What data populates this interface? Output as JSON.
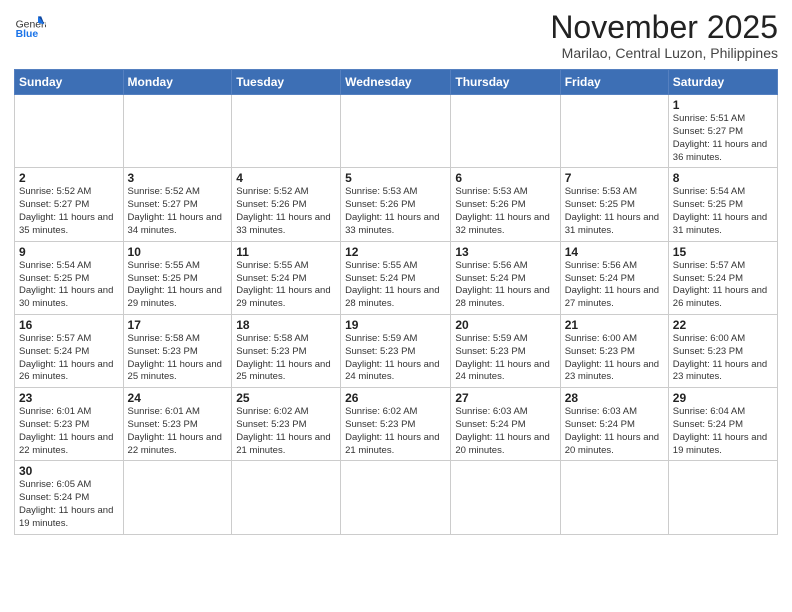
{
  "header": {
    "logo_general": "General",
    "logo_blue": "Blue",
    "month_title": "November 2025",
    "location": "Marilao, Central Luzon, Philippines"
  },
  "weekdays": [
    "Sunday",
    "Monday",
    "Tuesday",
    "Wednesday",
    "Thursday",
    "Friday",
    "Saturday"
  ],
  "weeks": [
    [
      {
        "day": "",
        "info": ""
      },
      {
        "day": "",
        "info": ""
      },
      {
        "day": "",
        "info": ""
      },
      {
        "day": "",
        "info": ""
      },
      {
        "day": "",
        "info": ""
      },
      {
        "day": "",
        "info": ""
      },
      {
        "day": "1",
        "info": "Sunrise: 5:51 AM\nSunset: 5:27 PM\nDaylight: 11 hours and 36 minutes."
      }
    ],
    [
      {
        "day": "2",
        "info": "Sunrise: 5:52 AM\nSunset: 5:27 PM\nDaylight: 11 hours and 35 minutes."
      },
      {
        "day": "3",
        "info": "Sunrise: 5:52 AM\nSunset: 5:27 PM\nDaylight: 11 hours and 34 minutes."
      },
      {
        "day": "4",
        "info": "Sunrise: 5:52 AM\nSunset: 5:26 PM\nDaylight: 11 hours and 33 minutes."
      },
      {
        "day": "5",
        "info": "Sunrise: 5:53 AM\nSunset: 5:26 PM\nDaylight: 11 hours and 33 minutes."
      },
      {
        "day": "6",
        "info": "Sunrise: 5:53 AM\nSunset: 5:26 PM\nDaylight: 11 hours and 32 minutes."
      },
      {
        "day": "7",
        "info": "Sunrise: 5:53 AM\nSunset: 5:25 PM\nDaylight: 11 hours and 31 minutes."
      },
      {
        "day": "8",
        "info": "Sunrise: 5:54 AM\nSunset: 5:25 PM\nDaylight: 11 hours and 31 minutes."
      }
    ],
    [
      {
        "day": "9",
        "info": "Sunrise: 5:54 AM\nSunset: 5:25 PM\nDaylight: 11 hours and 30 minutes."
      },
      {
        "day": "10",
        "info": "Sunrise: 5:55 AM\nSunset: 5:25 PM\nDaylight: 11 hours and 29 minutes."
      },
      {
        "day": "11",
        "info": "Sunrise: 5:55 AM\nSunset: 5:24 PM\nDaylight: 11 hours and 29 minutes."
      },
      {
        "day": "12",
        "info": "Sunrise: 5:55 AM\nSunset: 5:24 PM\nDaylight: 11 hours and 28 minutes."
      },
      {
        "day": "13",
        "info": "Sunrise: 5:56 AM\nSunset: 5:24 PM\nDaylight: 11 hours and 28 minutes."
      },
      {
        "day": "14",
        "info": "Sunrise: 5:56 AM\nSunset: 5:24 PM\nDaylight: 11 hours and 27 minutes."
      },
      {
        "day": "15",
        "info": "Sunrise: 5:57 AM\nSunset: 5:24 PM\nDaylight: 11 hours and 26 minutes."
      }
    ],
    [
      {
        "day": "16",
        "info": "Sunrise: 5:57 AM\nSunset: 5:24 PM\nDaylight: 11 hours and 26 minutes."
      },
      {
        "day": "17",
        "info": "Sunrise: 5:58 AM\nSunset: 5:23 PM\nDaylight: 11 hours and 25 minutes."
      },
      {
        "day": "18",
        "info": "Sunrise: 5:58 AM\nSunset: 5:23 PM\nDaylight: 11 hours and 25 minutes."
      },
      {
        "day": "19",
        "info": "Sunrise: 5:59 AM\nSunset: 5:23 PM\nDaylight: 11 hours and 24 minutes."
      },
      {
        "day": "20",
        "info": "Sunrise: 5:59 AM\nSunset: 5:23 PM\nDaylight: 11 hours and 24 minutes."
      },
      {
        "day": "21",
        "info": "Sunrise: 6:00 AM\nSunset: 5:23 PM\nDaylight: 11 hours and 23 minutes."
      },
      {
        "day": "22",
        "info": "Sunrise: 6:00 AM\nSunset: 5:23 PM\nDaylight: 11 hours and 23 minutes."
      }
    ],
    [
      {
        "day": "23",
        "info": "Sunrise: 6:01 AM\nSunset: 5:23 PM\nDaylight: 11 hours and 22 minutes."
      },
      {
        "day": "24",
        "info": "Sunrise: 6:01 AM\nSunset: 5:23 PM\nDaylight: 11 hours and 22 minutes."
      },
      {
        "day": "25",
        "info": "Sunrise: 6:02 AM\nSunset: 5:23 PM\nDaylight: 11 hours and 21 minutes."
      },
      {
        "day": "26",
        "info": "Sunrise: 6:02 AM\nSunset: 5:23 PM\nDaylight: 11 hours and 21 minutes."
      },
      {
        "day": "27",
        "info": "Sunrise: 6:03 AM\nSunset: 5:24 PM\nDaylight: 11 hours and 20 minutes."
      },
      {
        "day": "28",
        "info": "Sunrise: 6:03 AM\nSunset: 5:24 PM\nDaylight: 11 hours and 20 minutes."
      },
      {
        "day": "29",
        "info": "Sunrise: 6:04 AM\nSunset: 5:24 PM\nDaylight: 11 hours and 19 minutes."
      }
    ],
    [
      {
        "day": "30",
        "info": "Sunrise: 6:05 AM\nSunset: 5:24 PM\nDaylight: 11 hours and 19 minutes."
      },
      {
        "day": "",
        "info": ""
      },
      {
        "day": "",
        "info": ""
      },
      {
        "day": "",
        "info": ""
      },
      {
        "day": "",
        "info": ""
      },
      {
        "day": "",
        "info": ""
      },
      {
        "day": "",
        "info": ""
      }
    ]
  ]
}
